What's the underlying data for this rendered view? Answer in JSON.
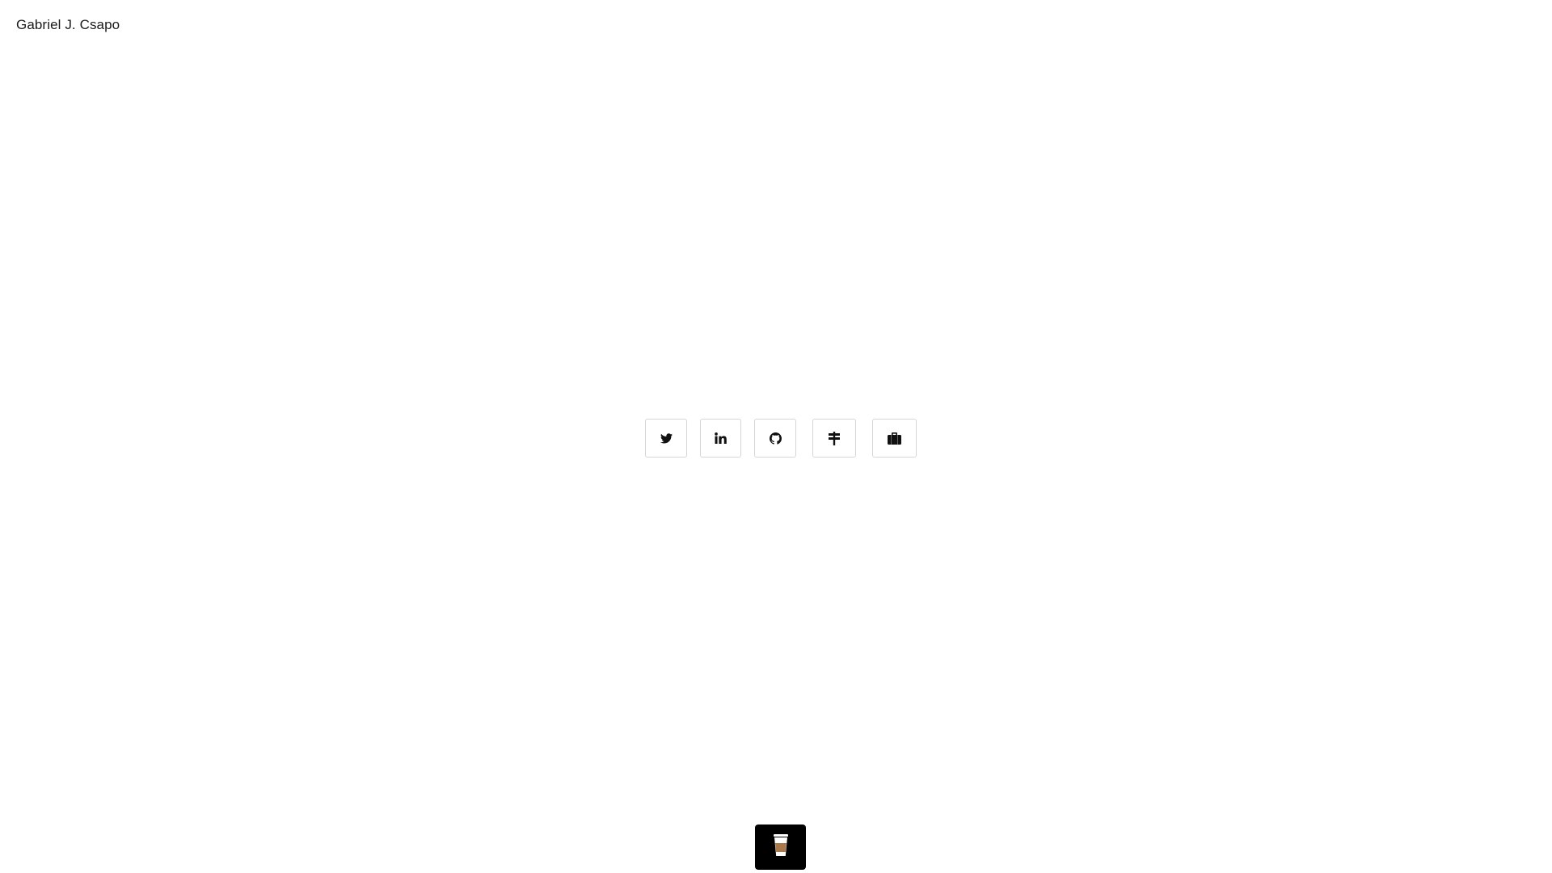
{
  "header": {
    "site_name": "Gabriel J. Csapo"
  },
  "social_links": [
    {
      "name": "twitter",
      "icon": "twitter-icon"
    },
    {
      "name": "linkedin",
      "icon": "linkedin-icon"
    },
    {
      "name": "github",
      "icon": "github-icon"
    },
    {
      "name": "signpost",
      "icon": "signpost-icon"
    },
    {
      "name": "portfolio",
      "icon": "briefcase-icon"
    }
  ],
  "footer": {
    "coffee_button_icon": "coffee-cup-icon"
  },
  "colors": {
    "background": "#ffffff",
    "text": "#1a1a1a",
    "button_border": "#d6d6d6",
    "icon": "#111111",
    "coffee_button_bg": "#000000",
    "coffee_fill": "#a9794a"
  }
}
